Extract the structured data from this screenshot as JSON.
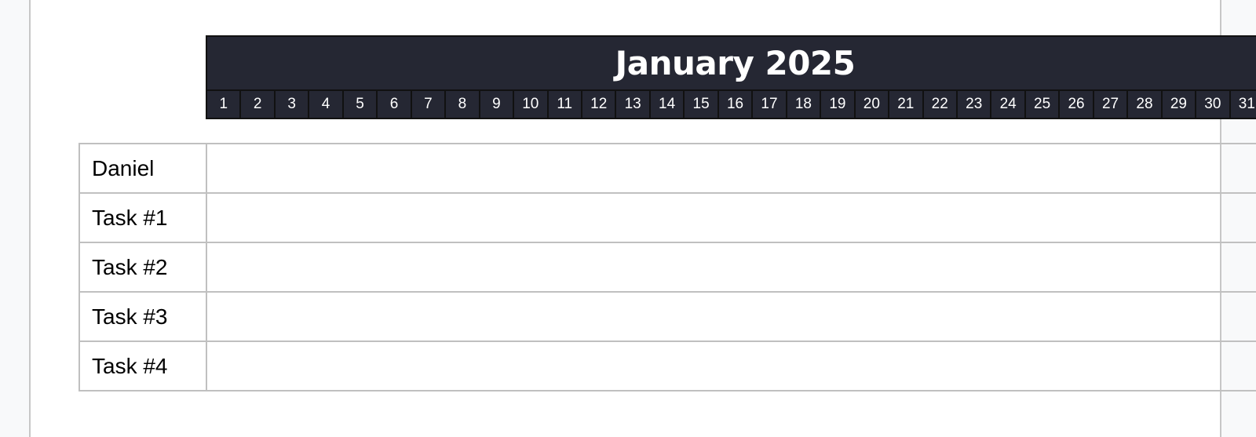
{
  "calendar": {
    "month_title": "January 2025",
    "days": [
      "1",
      "2",
      "3",
      "4",
      "5",
      "6",
      "7",
      "8",
      "9",
      "10",
      "11",
      "12",
      "13",
      "14",
      "15",
      "16",
      "17",
      "18",
      "19",
      "20",
      "21",
      "22",
      "23",
      "24",
      "25",
      "26",
      "27",
      "28",
      "29",
      "30",
      "31"
    ],
    "header_color": "#252733"
  },
  "table": {
    "rows": [
      {
        "label": "Daniel"
      },
      {
        "label": "Task #1"
      },
      {
        "label": "Task #2"
      },
      {
        "label": "Task #3"
      },
      {
        "label": "Task #4"
      }
    ]
  }
}
